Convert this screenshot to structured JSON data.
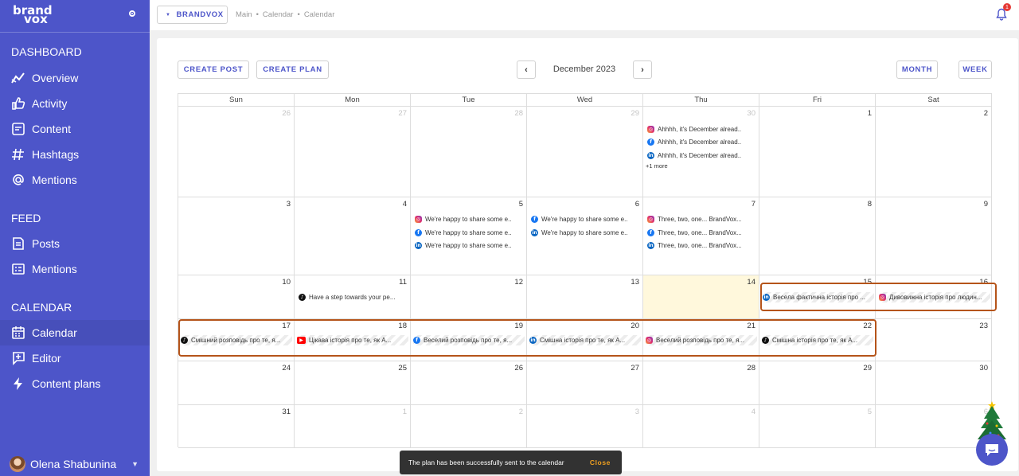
{
  "sidebar": {
    "logo_line1": "brand",
    "logo_line2": "vox",
    "sections": {
      "dashboard": "DASHBOARD",
      "feed": "FEED",
      "calendar": "CALENDAR"
    },
    "items": [
      {
        "label": "Overview",
        "icon": "overview-chart-icon"
      },
      {
        "label": "Activity",
        "icon": "thumbs-up-icon"
      },
      {
        "label": "Content",
        "icon": "content-icon"
      },
      {
        "label": "Hashtags",
        "icon": "hashtag-icon"
      },
      {
        "label": "Mentions",
        "icon": "at-icon"
      },
      {
        "label": "Posts",
        "icon": "posts-icon"
      },
      {
        "label": "Mentions",
        "icon": "list-icon"
      },
      {
        "label": "Calendar",
        "icon": "calendar-icon",
        "active": true
      },
      {
        "label": "Editor",
        "icon": "editor-icon"
      },
      {
        "label": "Content plans",
        "icon": "bolt-icon"
      }
    ],
    "user": {
      "name": "Olena Shabunina"
    }
  },
  "topbar": {
    "brand_button": "BRANDVOX",
    "breadcrumbs": [
      "Main",
      "•",
      "Calendar",
      "•",
      "Calendar"
    ],
    "notification_count": "1"
  },
  "toolbar": {
    "create_post": "CREATE POST",
    "create_plan": "CREATE PLAN",
    "month_label": "December 2023",
    "month_view": "MONTH",
    "week_view": "WEEK"
  },
  "calendar": {
    "weekdays": [
      "Sun",
      "Mon",
      "Tue",
      "Wed",
      "Thu",
      "Fri",
      "Sat"
    ],
    "weeks": [
      [
        "26",
        "27",
        "28",
        "29",
        "30",
        "1",
        "2"
      ],
      [
        "3",
        "4",
        "5",
        "6",
        "7",
        "8",
        "9"
      ],
      [
        "10",
        "11",
        "12",
        "13",
        "14",
        "15",
        "16"
      ],
      [
        "17",
        "18",
        "19",
        "20",
        "21",
        "22",
        "23"
      ],
      [
        "24",
        "25",
        "26",
        "27",
        "28",
        "29",
        "30"
      ],
      [
        "31",
        "1",
        "2",
        "3",
        "4",
        "5",
        "6"
      ]
    ],
    "today": "14",
    "events": {
      "thu_30": [
        "Ahhhh, it's December alread...",
        "Ahhhh, it's December alread...",
        "Ahhhh, it's December alread..."
      ],
      "thu_30_more": "+1 more",
      "tue_5": [
        "We're happy to share some e...",
        "We're happy to share some e...",
        "We're happy to share some e..."
      ],
      "wed_6": [
        "We're happy to share some e...",
        "We're happy to share some e..."
      ],
      "thu_7": [
        "Three, two, one... BrandVox...",
        "Three, two, one... BrandVox...",
        "Three, two, one... BrandVox..."
      ],
      "mon_11": "Have a step towards your pe...",
      "fri_15": "Весела фактична історія про ...",
      "sat_16": "Дивовижна історія про людин...",
      "sun_17": "Смішний розповідь про те, я...",
      "mon_18": "Цікава історія про те, як А...",
      "tue_19": "Веселий розповідь про те, я...",
      "wed_20": "Смішна історія про те, як А...",
      "thu_21": "Веселий розповідь про те, я...",
      "fri_22": "Смішна історія про те, як А..."
    }
  },
  "toast": {
    "message": "The plan has been successfully sent to the calendar",
    "action": "Close"
  },
  "colors": {
    "sidebar": "#4d55c9",
    "accent": "#4d55c9",
    "today": "#fff8dc",
    "highlight": "#b5541a"
  }
}
